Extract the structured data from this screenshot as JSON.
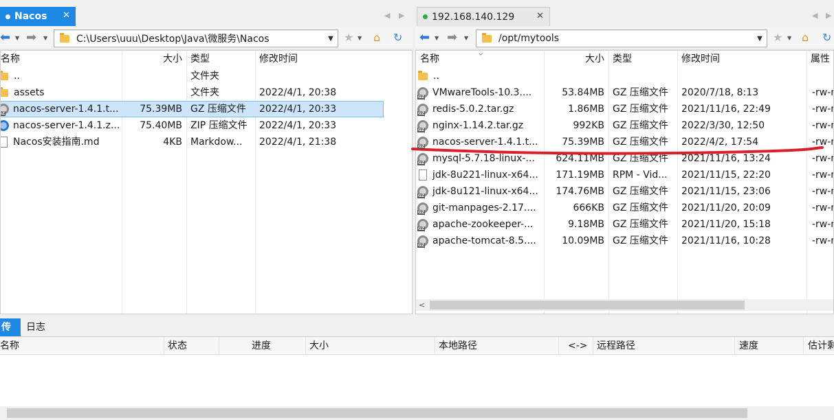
{
  "left": {
    "tab": {
      "title": "Nacos",
      "close": "✕"
    },
    "path": "C:\\Users\\uuu\\Desktop\\Java\\微服务\\Nacos",
    "columns": {
      "name": "名称",
      "size": "大小",
      "type": "类型",
      "modified": "修改时间"
    },
    "rows": [
      {
        "icon": "folder",
        "name": "..",
        "size": "",
        "type": "文件夹",
        "modified": ""
      },
      {
        "icon": "folder",
        "name": "assets",
        "size": "",
        "type": "文件夹",
        "modified": "2022/4/1, 20:38"
      },
      {
        "icon": "gz",
        "name": "nacos-server-1.4.1.t...",
        "size": "75.39MB",
        "type": "GZ 压缩文件",
        "modified": "2022/4/1, 20:33",
        "selected": true
      },
      {
        "icon": "zip",
        "name": "nacos-server-1.4.1.z...",
        "size": "75.40MB",
        "type": "ZIP 压缩文件",
        "modified": "2022/4/1, 20:33"
      },
      {
        "icon": "doc",
        "name": "Nacos安装指南.md",
        "size": "4KB",
        "type": "Markdow...",
        "modified": "2022/4/1, 21:38"
      }
    ]
  },
  "right": {
    "tab": {
      "title": "192.168.140.129",
      "close": "✕",
      "status_color": "#2fa84f"
    },
    "path": "/opt/mytools",
    "columns": {
      "name": "名称",
      "size": "大小",
      "type": "类型",
      "modified": "修改时间",
      "attrs": "属性"
    },
    "rows": [
      {
        "icon": "folder",
        "name": "..",
        "size": "",
        "type": "",
        "modified": "",
        "attrs": ""
      },
      {
        "icon": "gz",
        "name": "VMwareTools-10.3....",
        "size": "53.84MB",
        "type": "GZ 压缩文件",
        "modified": "2020/7/18, 8:13",
        "attrs": "-rw-r"
      },
      {
        "icon": "gz",
        "name": "redis-5.0.2.tar.gz",
        "size": "1.86MB",
        "type": "GZ 压缩文件",
        "modified": "2021/11/16, 22:49",
        "attrs": "-rw-r"
      },
      {
        "icon": "gz",
        "name": "nginx-1.14.2.tar.gz",
        "size": "992KB",
        "type": "GZ 压缩文件",
        "modified": "2022/3/30, 12:50",
        "attrs": "-rw-r"
      },
      {
        "icon": "gz",
        "name": "nacos-server-1.4.1.t...",
        "size": "75.39MB",
        "type": "GZ 压缩文件",
        "modified": "2022/4/2, 17:54",
        "attrs": "-rw-r"
      },
      {
        "icon": "gz",
        "name": "mysql-5.7.18-linux-...",
        "size": "624.11MB",
        "type": "GZ 压缩文件",
        "modified": "2021/11/16, 13:24",
        "attrs": "-rw-r"
      },
      {
        "icon": "doc",
        "name": "jdk-8u221-linux-x64...",
        "size": "171.19MB",
        "type": "RPM - Vid...",
        "modified": "2021/11/15, 22:20",
        "attrs": "-rw-r"
      },
      {
        "icon": "gz",
        "name": "jdk-8u121-linux-x64...",
        "size": "174.76MB",
        "type": "GZ 压缩文件",
        "modified": "2021/11/15, 23:06",
        "attrs": "-rw-r"
      },
      {
        "icon": "gz",
        "name": "git-manpages-2.17....",
        "size": "666KB",
        "type": "GZ 压缩文件",
        "modified": "2021/11/20, 20:09",
        "attrs": "-rw-r"
      },
      {
        "icon": "gz",
        "name": "apache-zookeeper-...",
        "size": "9.18MB",
        "type": "GZ 压缩文件",
        "modified": "2021/11/20, 15:18",
        "attrs": "-rw-r"
      },
      {
        "icon": "gz",
        "name": "apache-tomcat-8.5....",
        "size": "10.09MB",
        "type": "GZ 压缩文件",
        "modified": "2021/11/16, 10:28",
        "attrs": "-rw-r"
      }
    ]
  },
  "queue": {
    "tabs": [
      "传输",
      "日志"
    ],
    "columns": [
      "名称",
      "状态",
      "进度",
      "大小",
      "本地路径",
      "<->",
      "远程路径",
      "速度",
      "估计剩"
    ]
  },
  "icons": {
    "nav_back": "back-arrow-icon",
    "nav_forward": "forward-arrow-icon",
    "bookmark": "star-icon",
    "home": "home-folder-icon",
    "refresh": "refresh-icon"
  },
  "colors": {
    "accent": "#1e88e5",
    "selection": "#cce5fb",
    "annotation": "#d9202a"
  }
}
